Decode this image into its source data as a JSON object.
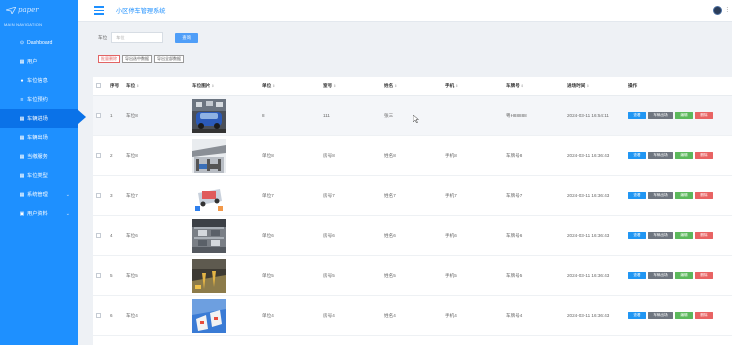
{
  "sidebar": {
    "logo": "paper",
    "nav_title": "MAIN NAVIGATION",
    "items": [
      {
        "label": "Dashboard",
        "icon": "dashboard-icon",
        "glyph": "⊙"
      },
      {
        "label": "用户",
        "icon": "grid-icon",
        "glyph": "▦"
      },
      {
        "label": "车位信息",
        "icon": "car-icon",
        "glyph": "●"
      },
      {
        "label": "车位预约",
        "icon": "list-icon",
        "glyph": "≡"
      },
      {
        "label": "车辆进场",
        "icon": "grid-icon",
        "glyph": "▦"
      },
      {
        "label": "车辆出场",
        "icon": "grid-icon",
        "glyph": "▦"
      },
      {
        "label": "当缴服务",
        "icon": "grid-icon",
        "glyph": "▦"
      },
      {
        "label": "车位类型",
        "icon": "grid-icon",
        "glyph": "▦"
      },
      {
        "label": "系统管理",
        "icon": "grid-icon",
        "glyph": "▦"
      },
      {
        "label": "用户资料",
        "icon": "card-icon",
        "glyph": "▣"
      }
    ]
  },
  "header": {
    "title": "小区停车管理系统"
  },
  "filter": {
    "label": "车位",
    "placeholder": "车位",
    "query": "查询"
  },
  "actions": {
    "batch_delete": "批量删除",
    "export_selected": "导出选中数据",
    "export_all": "导出全部数据"
  },
  "table": {
    "headers": [
      "序号",
      "车位",
      "车位图片",
      "单位",
      "室号",
      "姓名",
      "手机",
      "车牌号",
      "进场时间",
      "操作"
    ],
    "ops": {
      "view": "查看",
      "exit": "车辆出场",
      "edit": "编辑",
      "delete": "删除"
    },
    "rows": [
      {
        "idx": "1",
        "spot": "车位8",
        "unit": "8",
        "room": "111",
        "name": "张三",
        "phone": "",
        "plate": "粤H88888",
        "time": "2024-03-11 16:54:11"
      },
      {
        "idx": "2",
        "spot": "车位8",
        "unit": "单位8",
        "room": "房号8",
        "name": "姓名8",
        "phone": "手机8",
        "plate": "车牌号8",
        "time": "2024-03-11 16:36:43"
      },
      {
        "idx": "3",
        "spot": "车位7",
        "unit": "单位7",
        "room": "房号7",
        "name": "姓名7",
        "phone": "手机7",
        "plate": "车牌号7",
        "time": "2024-03-11 16:36:43"
      },
      {
        "idx": "4",
        "spot": "车位6",
        "unit": "单位6",
        "room": "房号6",
        "name": "姓名6",
        "phone": "手机6",
        "plate": "车牌号6",
        "time": "2024-03-11 16:36:43"
      },
      {
        "idx": "5",
        "spot": "车位5",
        "unit": "单位5",
        "room": "房号5",
        "name": "姓名5",
        "phone": "手机5",
        "plate": "车牌号5",
        "time": "2024-03-11 16:36:43"
      },
      {
        "idx": "6",
        "spot": "车位4",
        "unit": "单位4",
        "room": "房号4",
        "name": "姓名4",
        "phone": "手机4",
        "plate": "车牌号4",
        "time": "2024-03-11 16:36:43"
      }
    ]
  }
}
